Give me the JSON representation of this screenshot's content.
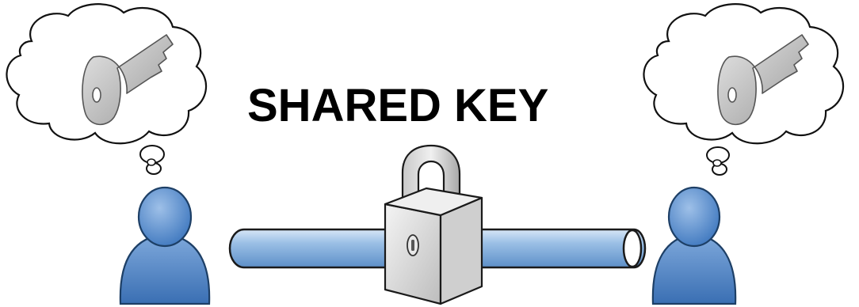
{
  "title": "SHARED KEY",
  "colors": {
    "person_fill": "#4f86c6",
    "person_stroke": "#1d3f66",
    "pipe_fill": "#8fb4dd",
    "pipe_stroke": "#1a1a1a",
    "lock_fill": "#dcdcdc",
    "lock_stroke": "#1a1a1a",
    "key_fill": "#cfcfcf",
    "cloud_stroke": "#111111"
  },
  "icons": {
    "left_thought": "thought-cloud-icon",
    "right_thought": "thought-cloud-icon",
    "key": "key-icon",
    "person": "person-icon",
    "lock": "padlock-icon",
    "channel": "pipe-icon"
  }
}
